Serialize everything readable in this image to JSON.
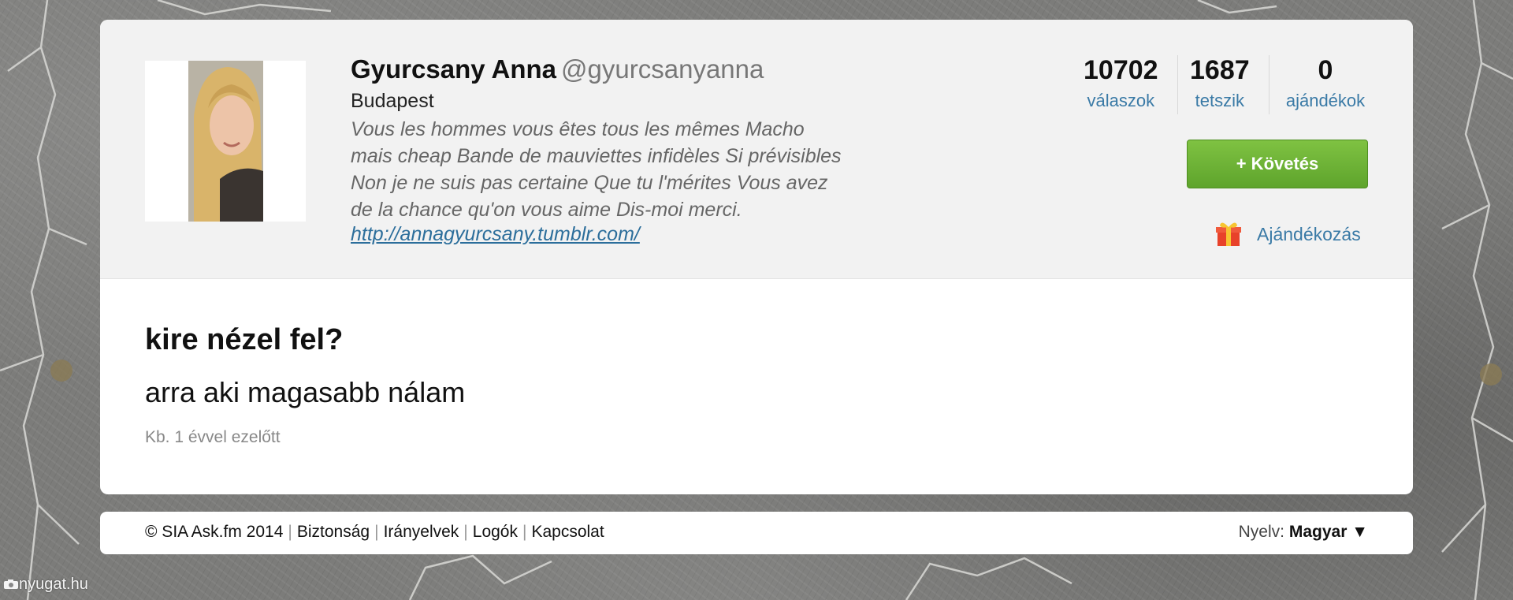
{
  "profile": {
    "name": "Gyurcsany Anna",
    "handle": "@gyurcsanyanna",
    "location": "Budapest",
    "bio_lines": [
      "Vous les hommes vous êtes tous les mêmes Macho",
      "mais cheap Bande de mauviettes infidèles Si prévisibles",
      "Non je ne suis pas certaine Que tu l'mérites Vous avez",
      "de la chance qu'on vous aime Dis-moi merci."
    ],
    "link": "http://annagyurcsany.tumblr.com/"
  },
  "stats": [
    {
      "value": "10702",
      "label": "válaszok"
    },
    {
      "value": "1687",
      "label": "tetszik"
    },
    {
      "value": "0",
      "label": "ajándékok"
    }
  ],
  "actions": {
    "follow_label": "+ Követés",
    "gift_label": "Ajándékozás"
  },
  "post": {
    "question": "kire nézel fel?",
    "answer": "arra aki magasabb nálam",
    "time": "Kb. 1 évvel ezelőtt"
  },
  "footer": {
    "copyright": "© SIA Ask.fm 2014",
    "links": [
      "Biztonság",
      "Irányelvek",
      "Logók",
      "Kapcsolat"
    ],
    "lang_label": "Nyelv:",
    "lang_value": "Magyar ▼"
  },
  "watermark": "nyugat.hu",
  "colors": {
    "accent_link": "#3a7aa6",
    "follow_button": "#6ab334",
    "gift_icon": "#e8422a"
  },
  "icons": {
    "gift": "gift-icon",
    "watermark_logo": "camera-logo-icon"
  }
}
